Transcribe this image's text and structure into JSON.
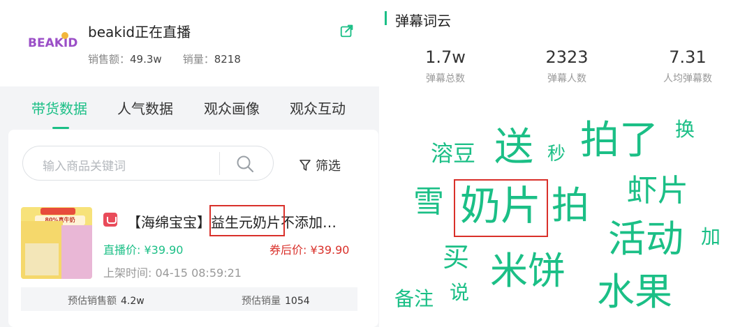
{
  "header": {
    "logo_text": "BEAKID",
    "streamer_title": "beakid正在直播",
    "sales_amount_label": "销售额：",
    "sales_amount_value": "49.3w",
    "sales_volume_label": "销量：",
    "sales_volume_value": "8218"
  },
  "tabs": [
    {
      "label": "带货数据",
      "active": true
    },
    {
      "label": "人气数据",
      "active": false
    },
    {
      "label": "观众画像",
      "active": false
    },
    {
      "label": "观众互动",
      "active": false
    }
  ],
  "search": {
    "placeholder": "输入商品关键词",
    "filter_label": "筛选"
  },
  "product": {
    "image_badge": "80%真牛奶",
    "title_prefix": "【海绵宝宝】",
    "title_highlight": "益生元奶片",
    "title_suffix": "不添加…",
    "live_price_label": "直播价: ",
    "live_price": "¥39.90",
    "coupon_price_label": "券后价: ",
    "coupon_price": "¥39.90",
    "listed_label": "上架时间: ",
    "listed_time": "04-15 08:59:21",
    "est_sales_amount_label": "预估销售额",
    "est_sales_amount": "4.2w",
    "est_sales_volume_label": "预估销量",
    "est_sales_volume": "1054"
  },
  "danmaku": {
    "section_title": "弹幕词云",
    "metrics": [
      {
        "value": "1.7w",
        "label": "弹幕总数"
      },
      {
        "value": "2323",
        "label": "弹幕人数"
      },
      {
        "value": "7.31",
        "label": "人均弹幕数"
      }
    ],
    "words": [
      "溶豆",
      "送",
      "秒",
      "拍了",
      "换",
      "雪",
      "奶片",
      "拍",
      "虾片",
      "活动",
      "加",
      "买",
      "米饼",
      "备注",
      "说",
      "水果"
    ]
  },
  "colors": {
    "accent": "#1bbf86",
    "highlight": "#d9302a",
    "coupon": "#d9302a"
  },
  "icons": [
    "share-icon",
    "search-icon",
    "filter-icon",
    "shop-icon"
  ]
}
